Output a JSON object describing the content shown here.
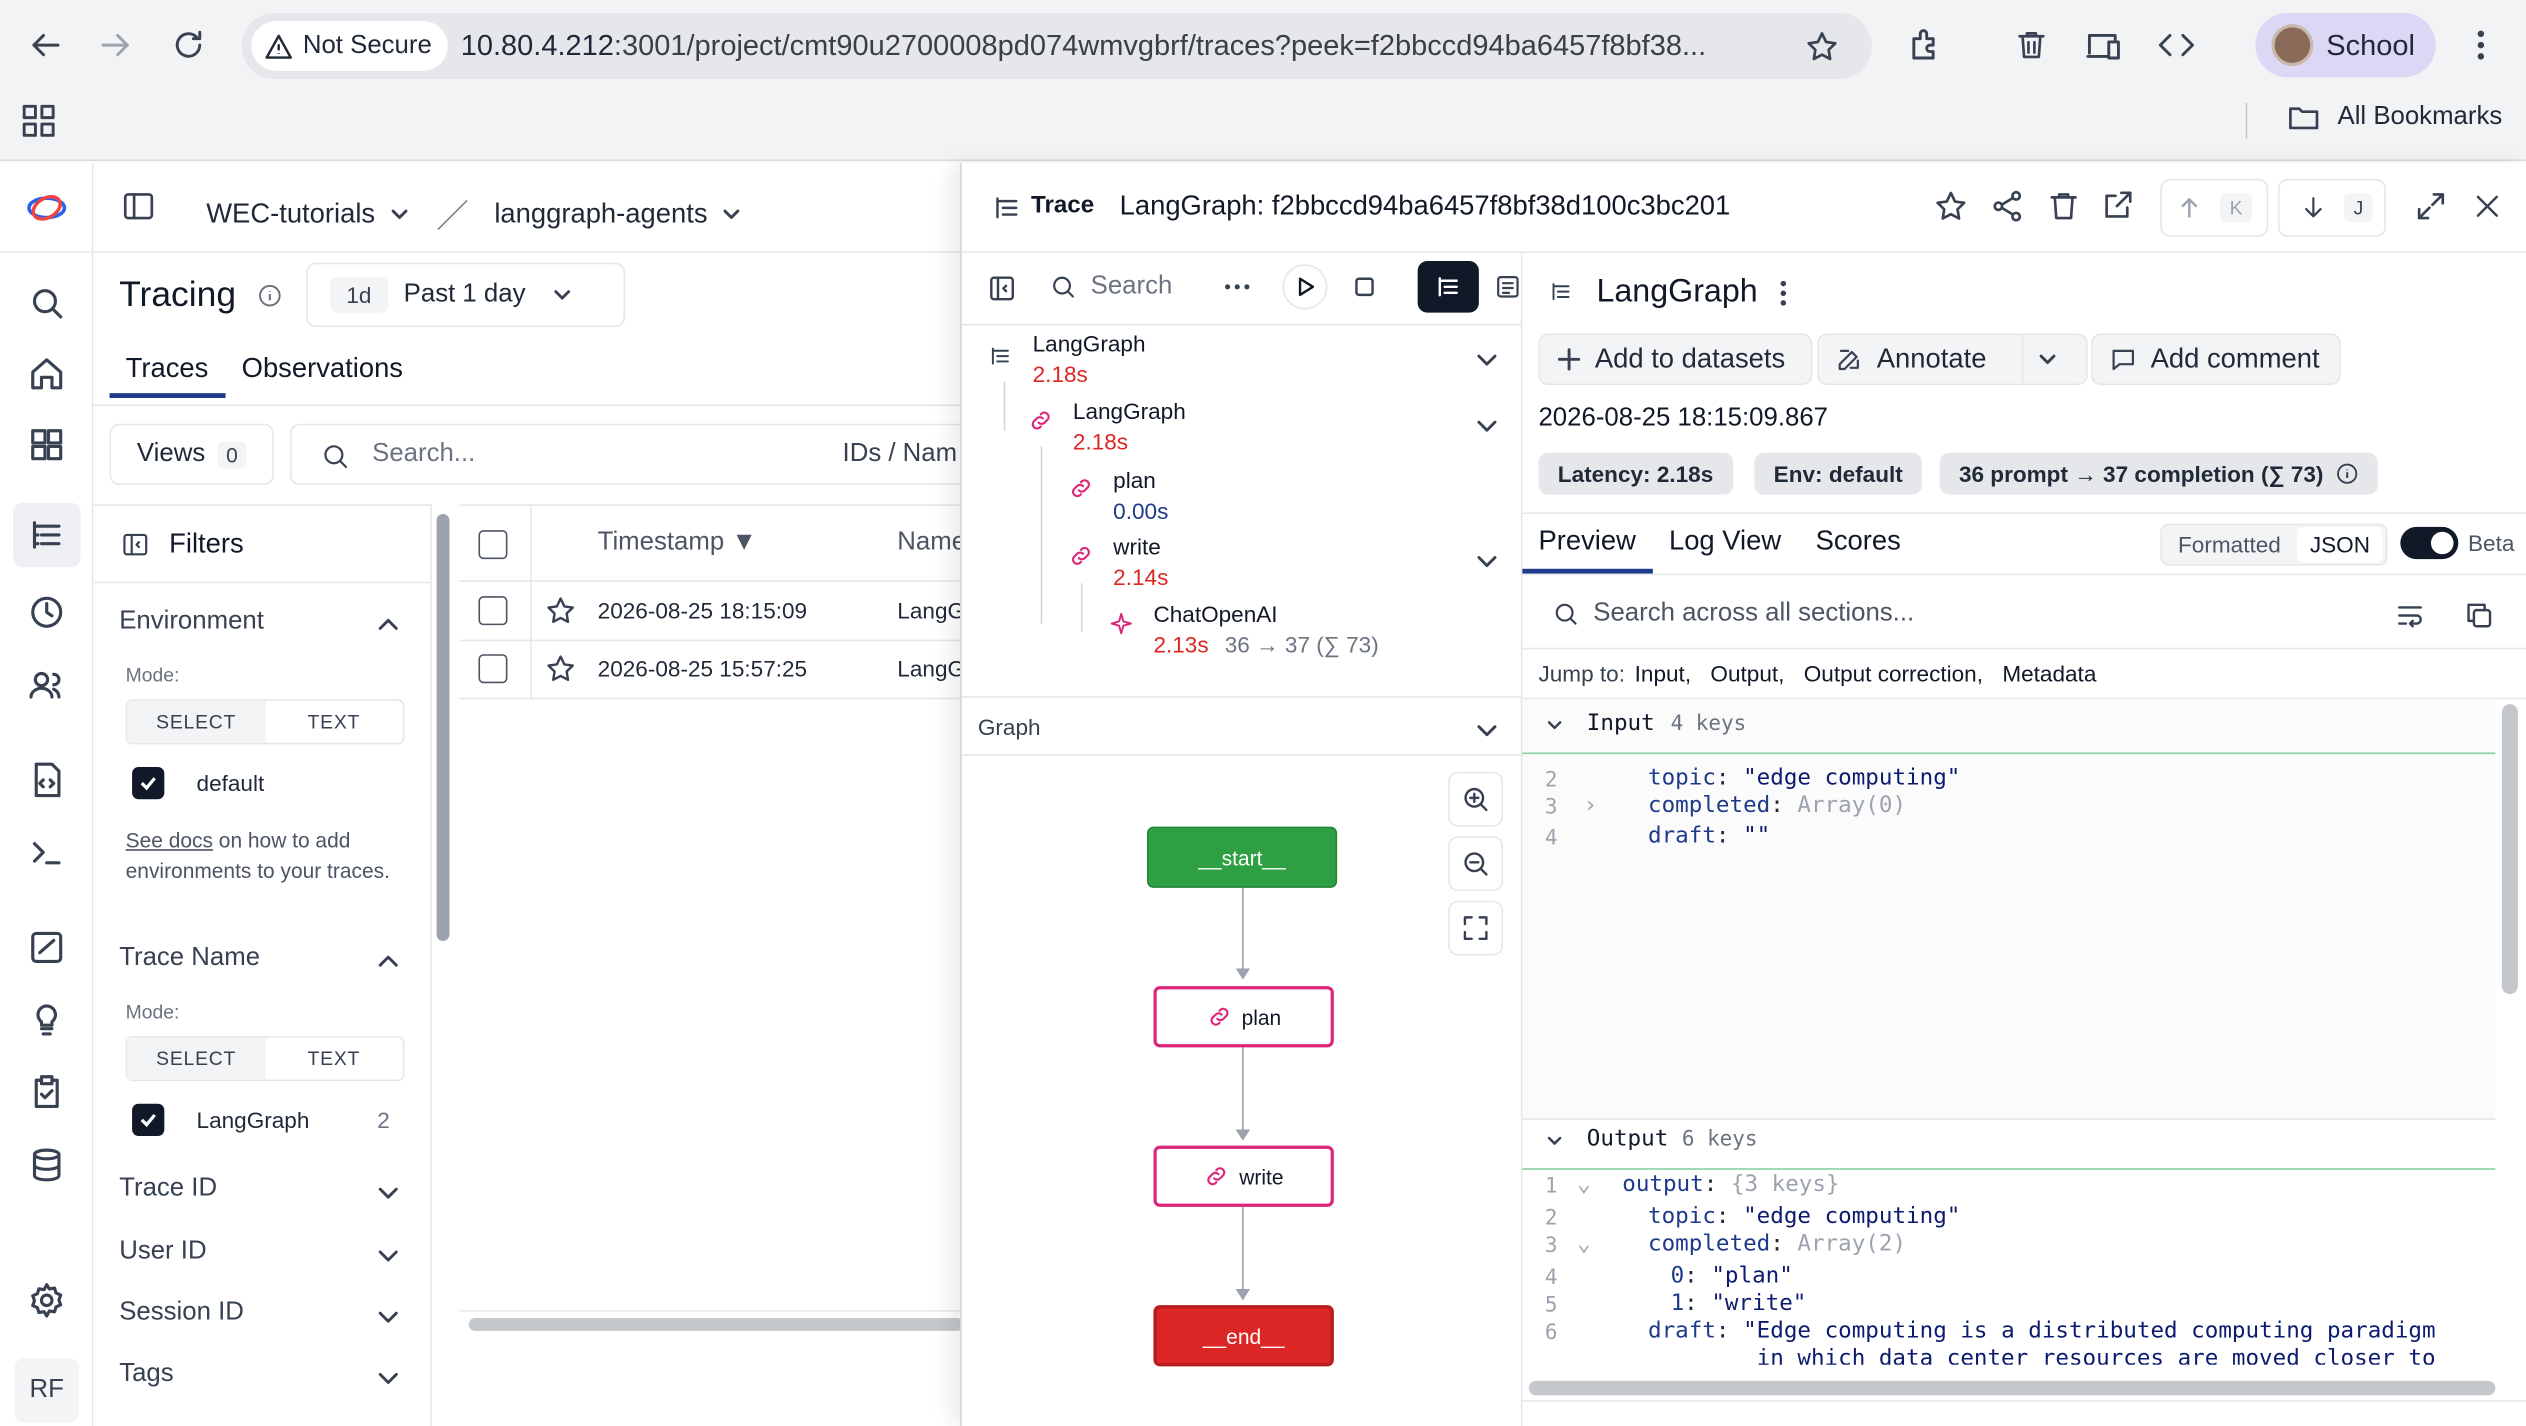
{
  "browser": {
    "not_secure": "Not Secure",
    "url_host": "10.80.4.212",
    "url_rest": ":3001/project/cmt90u2700008pd074wmvgbrf/traces?peek=f2bbccd94ba6457f8bf38...",
    "profile_name": "School",
    "all_bookmarks": "All Bookmarks"
  },
  "app": {
    "org": "WEC-tutorials",
    "project": "langgraph-agents",
    "page_title": "Tracing",
    "range_badge": "1d",
    "range_label": "Past 1 day",
    "tabs": [
      "Traces",
      "Observations"
    ],
    "views_label": "Views",
    "views_count": "0",
    "search_placeholder": "Search...",
    "search_scope": "IDs / Nam",
    "avatar_initials": "RF"
  },
  "filters": {
    "title": "Filters",
    "environment": "Environment",
    "mode_label": "Mode:",
    "select_label": "SELECT",
    "text_label": "TEXT",
    "env_value": "default",
    "docs_link": "See docs",
    "docs_text": " on how to add environments to your traces.",
    "trace_name": "Trace Name",
    "trace_value": "LangGraph",
    "trace_count": "2",
    "collapsed": [
      "Trace ID",
      "User ID",
      "Session ID",
      "Tags"
    ]
  },
  "table": {
    "col_timestamp": "Timestamp ▼",
    "col_name": "Name",
    "rows": [
      {
        "ts": "2026-08-25 18:15:09",
        "name": "LangG"
      },
      {
        "ts": "2026-08-25 15:57:25",
        "name": "LangG"
      }
    ]
  },
  "peek": {
    "kind": "Trace",
    "title": "LangGraph: f2bbccd94ba6457f8bf38d100c3bc201",
    "key_up": "K",
    "key_down": "J",
    "search": "Search",
    "graph_label": "Graph",
    "tree": [
      {
        "name": "LangGraph",
        "dur": "2.18s"
      },
      {
        "name": "LangGraph",
        "dur": "2.18s"
      },
      {
        "name": "plan",
        "dur": "0.00s"
      },
      {
        "name": "write",
        "dur": "2.14s"
      },
      {
        "name": "ChatOpenAI",
        "dur": "2.13s",
        "tokens": "36 → 37 (∑ 73)"
      }
    ],
    "graph_nodes": [
      "__start__",
      "plan",
      "write",
      "__end__"
    ]
  },
  "detail": {
    "title": "LangGraph",
    "add_datasets": "Add to datasets",
    "annotate": "Annotate",
    "add_comment": "Add comment",
    "timestamp": "2026-08-25 18:15:09.867",
    "latency": "Latency: 2.18s",
    "env": "Env: default",
    "tokens": "36 prompt → 37 completion (∑ 73)",
    "tabs": [
      "Preview",
      "Log View",
      "Scores"
    ],
    "formatted": "Formatted",
    "json": "JSON",
    "beta": "Beta",
    "search_placeholder": "Search across all sections...",
    "jump_to": "Jump to:",
    "jump_links": [
      "Input,",
      "Output,",
      "Output correction,",
      "Metadata"
    ],
    "input_label": "Input",
    "input_keys": "4 keys",
    "output_label": "Output",
    "output_keys": "6 keys"
  },
  "colors": {
    "accent": "#1e3a8a",
    "start": "#2ea043",
    "end": "#dc2626",
    "node_border": "#db2777",
    "duration": "#dc2626"
  }
}
